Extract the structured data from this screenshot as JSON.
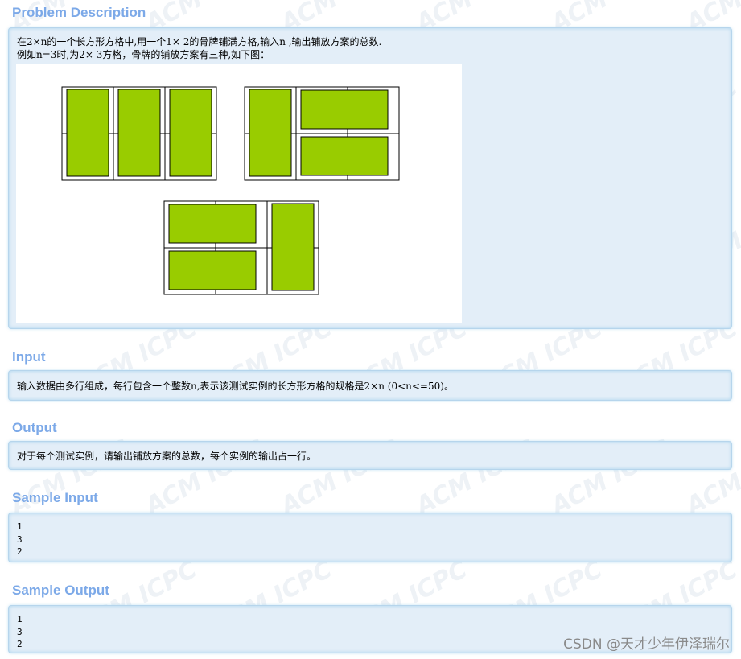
{
  "watermark": {
    "text": "ACM ICPC"
  },
  "sections": {
    "problem_description": {
      "title": "Problem Description",
      "lines": [
        "在2×n的一个长方形方格中,用一个1× 2的骨牌铺满方格,输入n ,输出铺放方案的总数.",
        "例如n=3时,为2× 3方格，骨牌的铺放方案有三种,如下图："
      ]
    },
    "input": {
      "title": "Input",
      "text": "输入数据由多行组成，每行包含一个整数n,表示该测试实例的长方形方格的规格是2×n (0<n<=50)。"
    },
    "output": {
      "title": "Output",
      "text": "对于每个测试实例，请输出铺放方案的总数，每个实例的输出占一行。"
    },
    "sample_input": {
      "title": "Sample Input",
      "lines": [
        "1",
        "3",
        "2"
      ]
    },
    "sample_output": {
      "title": "Sample Output",
      "lines": [
        "1",
        "3",
        "2"
      ]
    }
  },
  "figure": {
    "domino_color": "#99cc00",
    "grid_color": "#000000"
  },
  "csdn_credit": "CSDN @天才少年伊泽瑞尔"
}
